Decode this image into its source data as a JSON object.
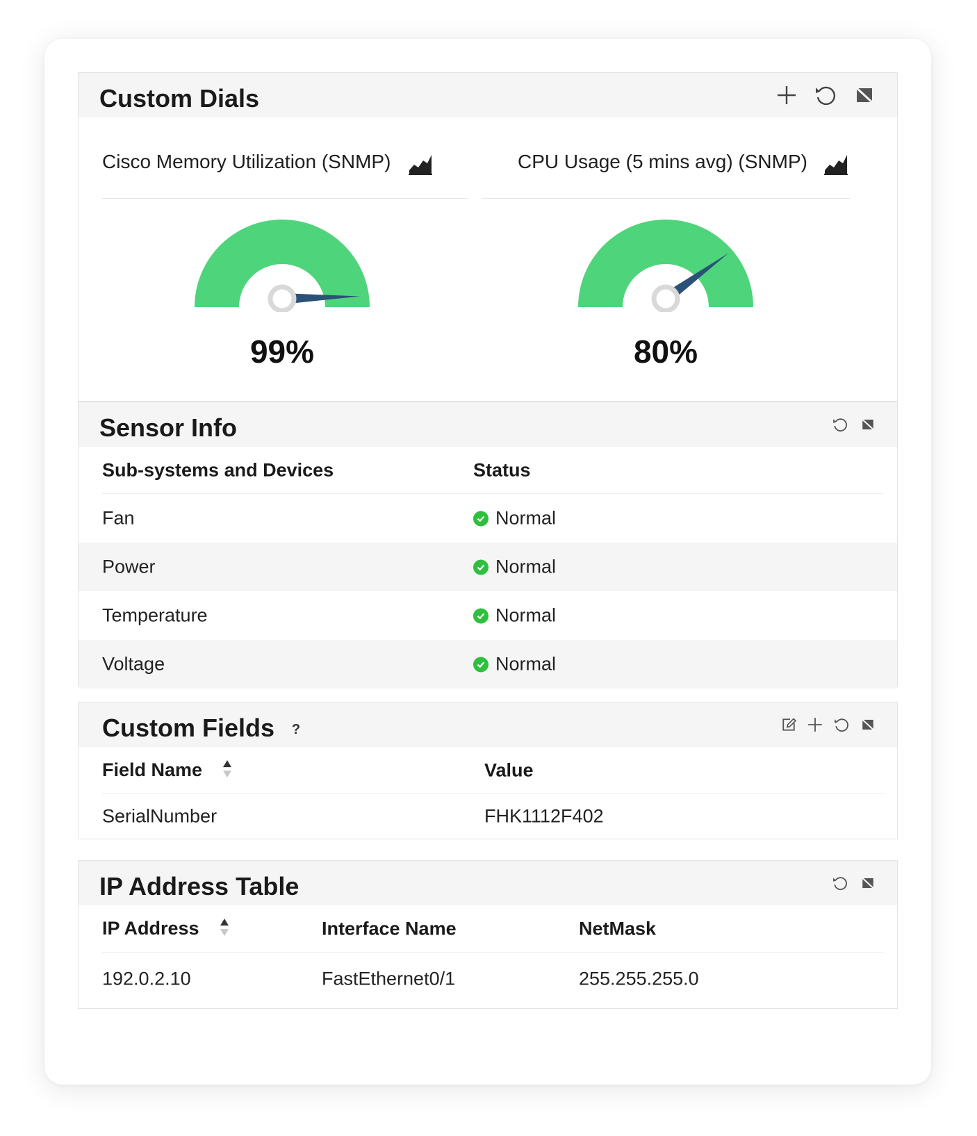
{
  "dials": {
    "title": "Custom Dials",
    "tools": [
      "plus-icon",
      "refresh-icon",
      "close-widget-icon"
    ],
    "items": [
      {
        "label": "Cisco Memory Utilization (SNMP)",
        "value": 99,
        "display": "99%"
      },
      {
        "label": "CPU Usage (5 mins avg) (SNMP)",
        "value": 80,
        "display": "80%"
      }
    ],
    "colors": {
      "arc": "#4ed47a",
      "needle": "#2c5178",
      "hub": "#d9d9d9"
    }
  },
  "sensor": {
    "title": "Sensor Info",
    "columns": [
      "Sub-systems and Devices",
      "Status"
    ],
    "rows": [
      {
        "name": "Fan",
        "status": "Normal"
      },
      {
        "name": "Power",
        "status": "Normal"
      },
      {
        "name": "Temperature",
        "status": "Normal"
      },
      {
        "name": "Voltage",
        "status": "Normal"
      }
    ],
    "status_color": "#2fbf3e"
  },
  "fields": {
    "title": "Custom Fields",
    "help": "?",
    "columns": [
      "Field Name",
      "Value"
    ],
    "rows": [
      {
        "name": "SerialNumber",
        "value": "FHK1112F402"
      }
    ]
  },
  "iptable": {
    "title": "IP Address Table",
    "columns": [
      "IP Address",
      "Interface Name",
      "NetMask"
    ],
    "rows": [
      {
        "ip": "192.0.2.10",
        "iface": "FastEthernet0/1",
        "mask": "255.255.255.0"
      }
    ]
  }
}
